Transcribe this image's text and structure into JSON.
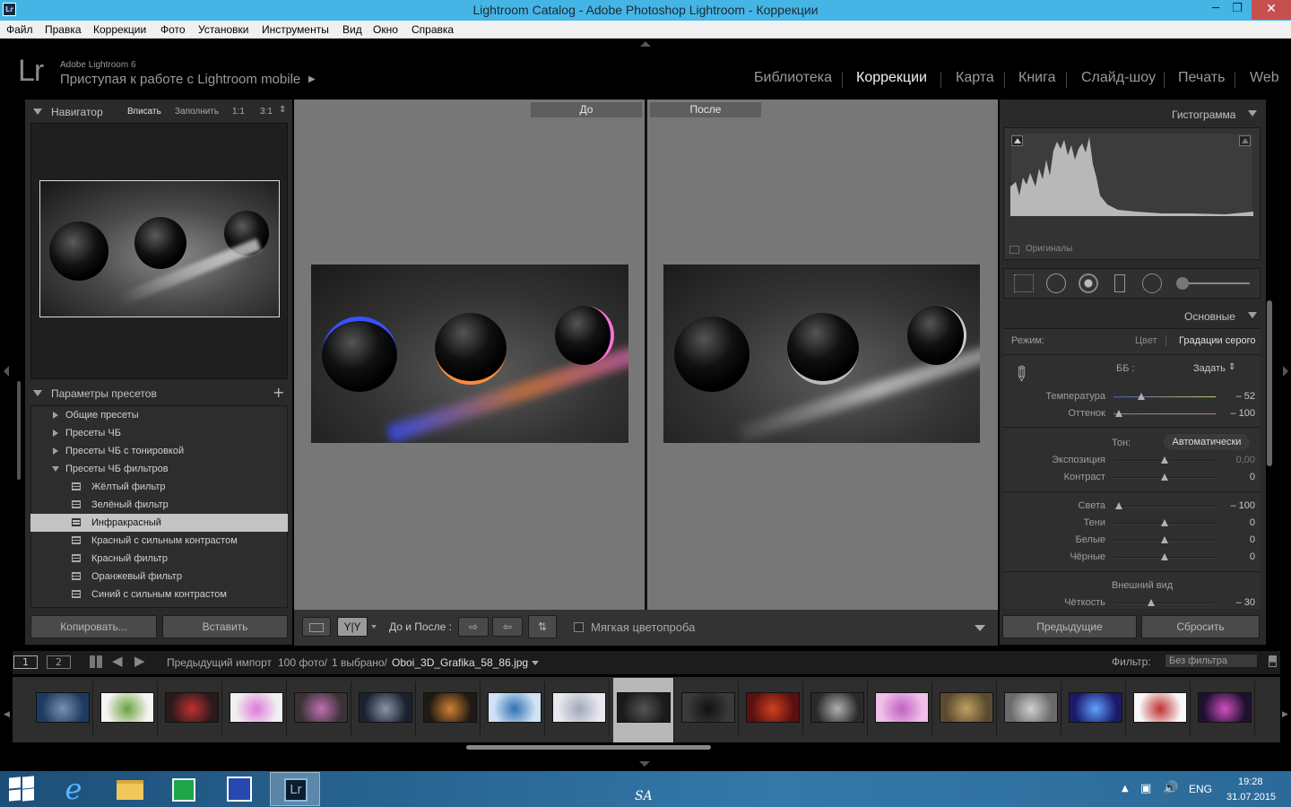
{
  "window": {
    "title": "Lightroom Catalog - Adobe Photoshop Lightroom - Коррекции",
    "app_icon": "Lr"
  },
  "menu": [
    "Файл",
    "Правка",
    "Коррекции",
    "Фото",
    "Установки",
    "Инструменты",
    "Вид",
    "Окно",
    "Справка"
  ],
  "identity": {
    "logo": "Lr",
    "version": "Adobe Lightroom 6",
    "mobile": "Приступая к работе с Lightroom mobile"
  },
  "modules": [
    "Библиотека",
    "Коррекции",
    "Карта",
    "Книга",
    "Слайд-шоу",
    "Печать",
    "Web"
  ],
  "active_module": "Коррекции",
  "navigator": {
    "title": "Навигатор",
    "fit": "Вписать",
    "fill": "Заполнить",
    "r1": "1:1",
    "r2": "3:1"
  },
  "presets": {
    "title": "Параметры пресетов",
    "add": "+",
    "folders": [
      "Общие пресеты",
      "Пресеты ЧБ",
      "Пресеты ЧБ с тонировкой",
      "Пресеты ЧБ фильтров"
    ],
    "items": [
      "Жёлтый фильтр",
      "Зелёный фильтр",
      "Инфракрасный",
      "Красный с сильным контрастом",
      "Красный фильтр",
      "Оранжевый фильтр",
      "Синий с сильным контрастом"
    ],
    "selected": "Инфракрасный"
  },
  "left_buttons": {
    "copy": "Копировать...",
    "paste": "Вставить"
  },
  "compare": {
    "before": "До",
    "after": "После"
  },
  "toolbar": {
    "yy": "Y|Y",
    "before_after": "До и После :",
    "soft_proof": "Мягкая цветопроба"
  },
  "histogram": {
    "title": "Гистограмма",
    "originals": "Оригиналы"
  },
  "basic": {
    "title": "Основные",
    "mode_label": "Режим:",
    "mode_color": "Цвет",
    "mode_bw": "Градации серого",
    "wb_label": "ББ :",
    "wb_value": "Задать",
    "tone_label": "Тон:",
    "tone_auto": "Автоматически",
    "presence": "Внешний вид",
    "sliders": [
      {
        "label": "Температура",
        "value": "– 52",
        "pos": 0.27,
        "gradient": "temp"
      },
      {
        "label": "Оттенок",
        "value": "– 100",
        "pos": 0.05,
        "gradient": "tint"
      },
      {
        "label": "Экспозиция",
        "value": "0,00",
        "pos": 0.5
      },
      {
        "label": "Контраст",
        "value": "0",
        "pos": 0.5
      },
      {
        "label": "Света",
        "value": "– 100",
        "pos": 0.05
      },
      {
        "label": "Тени",
        "value": "0",
        "pos": 0.5
      },
      {
        "label": "Белые",
        "value": "0",
        "pos": 0.5
      },
      {
        "label": "Чёрные",
        "value": "0",
        "pos": 0.5
      },
      {
        "label": "Чёткость",
        "value": "– 30",
        "pos": 0.37
      }
    ]
  },
  "right_buttons": {
    "previous": "Предыдущие",
    "reset": "Сбросить"
  },
  "filmstrip_bar": {
    "page1": "1",
    "page2": "2",
    "source": "Предыдущий импорт",
    "count": "100 фото/",
    "selected": "1 выбрано/",
    "file": "Oboi_3D_Grafika_58_86.jpg",
    "filter_label": "Фильтр:",
    "filter_value": "Без фильтра"
  },
  "filmstrip": [
    {
      "a": "#1d3a60",
      "b": "#7a8fb0"
    },
    {
      "a": "#f4f4f4",
      "b": "#6aa23c"
    },
    {
      "a": "#2a1a1a",
      "b": "#c03030"
    },
    {
      "a": "#f0f0f0",
      "b": "#e07ad8"
    },
    {
      "a": "#3a3236",
      "b": "#c070b0"
    },
    {
      "a": "#1b2130",
      "b": "#8a94a8"
    },
    {
      "a": "#201a14",
      "b": "#d08030"
    },
    {
      "a": "#cfe3f5",
      "b": "#3070b0"
    },
    {
      "a": "#e8e8ee",
      "b": "#a0a8b8"
    },
    {
      "a": "#1a1a1a",
      "b": "#555555"
    },
    {
      "a": "#3a3a3a",
      "b": "#111111"
    },
    {
      "a": "#5a1010",
      "b": "#d04020"
    },
    {
      "a": "#2a2a2a",
      "b": "#b0b0b0"
    },
    {
      "a": "#f0c0e8",
      "b": "#c060c0"
    },
    {
      "a": "#5a4a30",
      "b": "#c0a060"
    },
    {
      "a": "#6a6a6a",
      "b": "#d0d0d0"
    },
    {
      "a": "#1a1a6a",
      "b": "#60a0ff"
    },
    {
      "a": "#f8f8f8",
      "b": "#c03030"
    },
    {
      "a": "#201030",
      "b": "#d050c0"
    }
  ],
  "taskbar": {
    "lang": "ENG",
    "time": "19:28",
    "date": "31.07.2015",
    "watermark": "SA"
  },
  "colors": {
    "panel": "#2a2a2a",
    "center": "#787878",
    "taskbar": "#2b6a99",
    "titlebar": "#45b5e5"
  }
}
